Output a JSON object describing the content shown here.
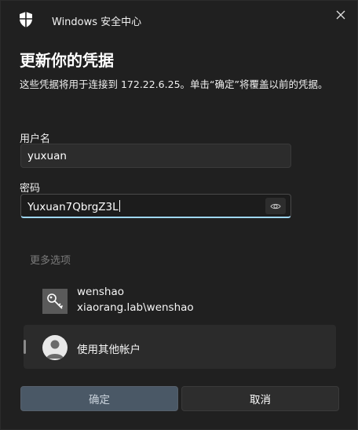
{
  "window": {
    "app_title": "Windows 安全中心",
    "heading": "更新你的凭据",
    "description": "这些凭据将用于连接到 172.22.6.25。单击“确定”将覆盖以前的凭据。"
  },
  "form": {
    "username_label": "用户名",
    "username_value": "yuxuan",
    "password_label": "密码",
    "password_value": "Yuxuan7QbrgZ3L"
  },
  "more_options": {
    "label": "更多选项",
    "accounts": [
      {
        "name": "wenshao",
        "domain_user": "xiaorang.lab\\wenshao",
        "icon": "key-icon"
      },
      {
        "name": "使用其他帐户",
        "icon": "user-avatar-icon"
      }
    ]
  },
  "buttons": {
    "ok": "确定",
    "cancel": "取消"
  },
  "colors": {
    "background": "#202020",
    "focus_accent": "#9fd7f5",
    "ok_button": "#4a5866"
  }
}
